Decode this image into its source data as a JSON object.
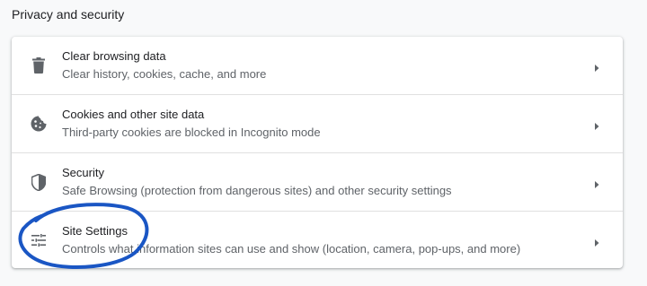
{
  "section": {
    "title": "Privacy and security"
  },
  "rows": [
    {
      "icon": "trash-icon",
      "title": "Clear browsing data",
      "subtitle": "Clear history, cookies, cache, and more"
    },
    {
      "icon": "cookie-icon",
      "title": "Cookies and other site data",
      "subtitle": "Third-party cookies are blocked in Incognito mode"
    },
    {
      "icon": "shield-icon",
      "title": "Security",
      "subtitle": "Safe Browsing (protection from dangerous sites) and other security settings"
    },
    {
      "icon": "tune-icon",
      "title": "Site Settings",
      "subtitle": "Controls what information sites can use and show (location, camera, pop-ups, and more)"
    }
  ],
  "colors": {
    "background": "#f8f9fa",
    "card": "#ffffff",
    "title_text": "#202124",
    "secondary_text": "#5f6368",
    "icon": "#5f6368",
    "annotation": "#1a56c4"
  }
}
